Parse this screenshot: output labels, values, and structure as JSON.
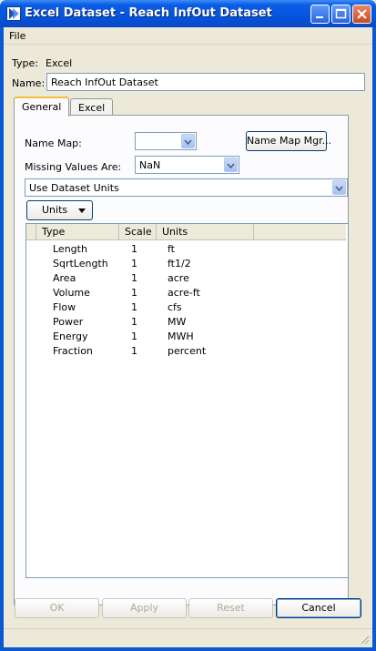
{
  "window": {
    "title": "Excel Dataset - Reach InfOut Dataset"
  },
  "menu": {
    "file": "File"
  },
  "info": {
    "type_label": "Type:",
    "type_value": "Excel",
    "name_label": "Name:",
    "name_value": "Reach InfOut Dataset"
  },
  "tabs": [
    {
      "label": "General",
      "active": true
    },
    {
      "label": "Excel",
      "active": false
    }
  ],
  "general": {
    "name_map_label": "Name Map:",
    "name_map_value": "",
    "name_map_mgr_button": "Name Map Mgr...",
    "missing_values_label": "Missing Values Are:",
    "missing_values_value": "NaN",
    "units_mode_value": "Use Dataset Units",
    "units_dropdown_button": "Units"
  },
  "table": {
    "columns": [
      "Type",
      "Scale",
      "Units"
    ],
    "rows": [
      [
        "Length",
        "1",
        "ft"
      ],
      [
        "SqrtLength",
        "1",
        "ft1/2"
      ],
      [
        "Area",
        "1",
        "acre"
      ],
      [
        "Volume",
        "1",
        "acre-ft"
      ],
      [
        "Flow",
        "1",
        "cfs"
      ],
      [
        "Power",
        "1",
        "MW"
      ],
      [
        "Energy",
        "1",
        "MWH"
      ],
      [
        "Fraction",
        "1",
        "percent"
      ]
    ]
  },
  "buttons": {
    "ok": "OK",
    "apply": "Apply",
    "reset": "Reset",
    "cancel": "Cancel"
  },
  "colors": {
    "title_bar": "#0454de",
    "dialog_bg": "#ece9d8",
    "active_tab_accent": "#f7b94a"
  },
  "icons": {
    "app": "app-logo-icon",
    "minimize": "minimize-icon",
    "maximize": "maximize-icon",
    "close": "close-icon",
    "dropdown": "chevron-down-icon"
  }
}
